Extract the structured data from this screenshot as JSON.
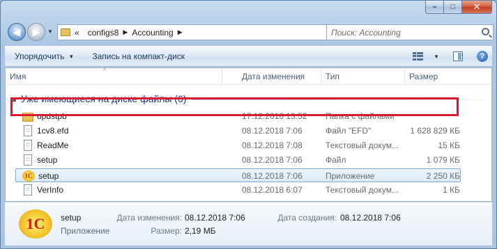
{
  "window": {
    "caption_buttons": {
      "minimize": "–",
      "maximize": "□",
      "close": "✕"
    }
  },
  "navigation": {
    "back_icon": "arrow-left-icon",
    "forward_icon": "arrow-right-icon",
    "breadcrumb_overflow": "«",
    "breadcrumbs": [
      "configs8",
      "Accounting"
    ],
    "search_placeholder": "Поиск: Accounting"
  },
  "toolbar": {
    "organize_label": "Упорядочить",
    "burn_label": "Запись на компакт-диск"
  },
  "columns": {
    "name": "Имя",
    "date": "Дата изменения",
    "type": "Тип",
    "size": "Размер"
  },
  "group": {
    "label": "Уже имеющиеся на диске файлы (6)"
  },
  "files": [
    {
      "name": "updstpb",
      "date": "17.12.2018 13:52",
      "type": "Папка с файлами",
      "size": "",
      "icon": "folder-icon"
    },
    {
      "name": "1cv8.efd",
      "date": "08.12.2018 7:06",
      "type": "Файл \"EFD\"",
      "size": "1 628 829 КБ",
      "icon": "document-icon"
    },
    {
      "name": "ReadMe",
      "date": "08.12.2018 7:08",
      "type": "Текстовый докум...",
      "size": "15 КБ",
      "icon": "document-icon"
    },
    {
      "name": "setup",
      "date": "08.12.2018 7:06",
      "type": "Файл",
      "size": "1 079 КБ",
      "icon": "document-icon"
    },
    {
      "name": "setup",
      "date": "08.12.2018 7:06",
      "type": "Приложение",
      "size": "2 250 КБ",
      "icon": "1c-app-icon",
      "selected": true
    },
    {
      "name": "VerInfo",
      "date": "08.12.2018 6:07",
      "type": "Текстовый докум...",
      "size": "1 КБ",
      "icon": "document-icon"
    }
  ],
  "details": {
    "name": "setup",
    "type": "Приложение",
    "modified_label": "Дата изменения:",
    "modified_value": "08.12.2018 7:06",
    "size_label": "Размер:",
    "size_value": "2,19 МБ",
    "created_label": "Дата создания:",
    "created_value": "08.12.2018 7:06",
    "logo_text": "1С"
  },
  "colors": {
    "selection_outline": "#d8192e",
    "group_header": "#1e3287"
  }
}
